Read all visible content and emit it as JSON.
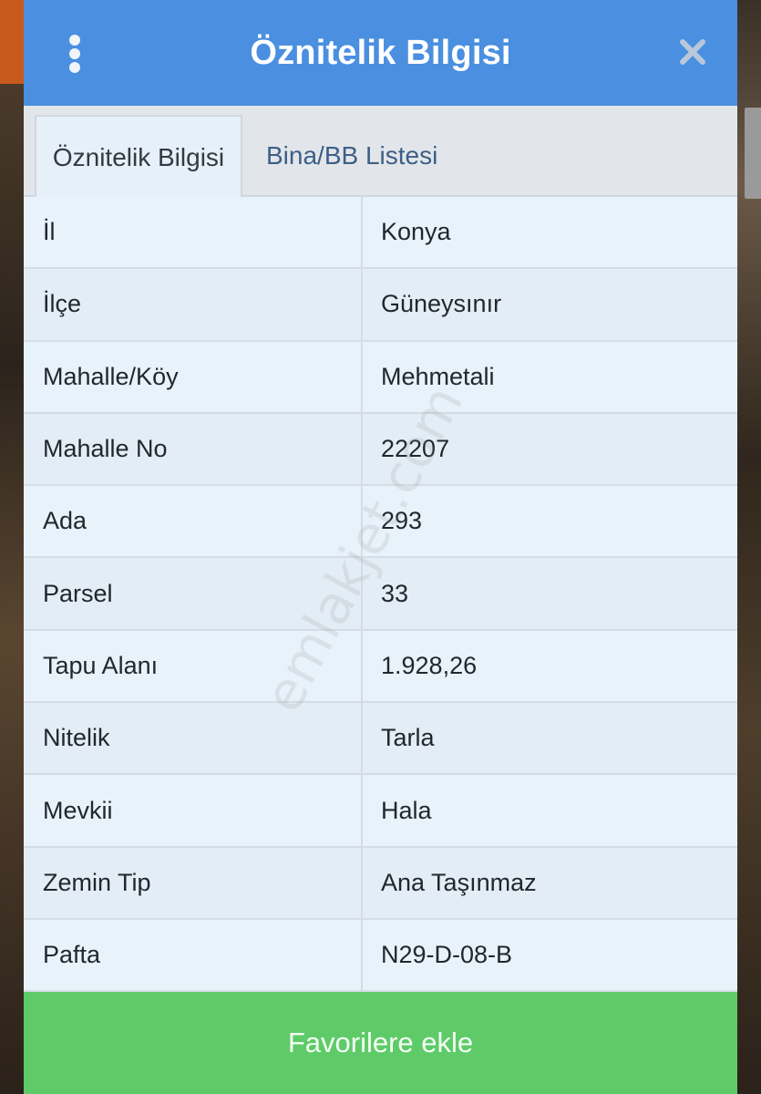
{
  "header": {
    "title": "Öznitelik Bilgisi"
  },
  "tabs": [
    {
      "label": "Öznitelik Bilgisi",
      "active": true
    },
    {
      "label": "Bina/BB Listesi",
      "active": false
    }
  ],
  "attributes": [
    {
      "key": "İl",
      "value": "Konya"
    },
    {
      "key": "İlçe",
      "value": "Güneysınır"
    },
    {
      "key": "Mahalle/Köy",
      "value": "Mehmetali"
    },
    {
      "key": "Mahalle No",
      "value": "22207"
    },
    {
      "key": "Ada",
      "value": "293"
    },
    {
      "key": "Parsel",
      "value": "33"
    },
    {
      "key": "Tapu Alanı",
      "value": "1.928,26"
    },
    {
      "key": "Nitelik",
      "value": "Tarla"
    },
    {
      "key": "Mevkii",
      "value": "Hala"
    },
    {
      "key": "Zemin Tip",
      "value": "Ana Taşınmaz"
    },
    {
      "key": "Pafta",
      "value": "N29-D-08-B"
    }
  ],
  "watermark": "emlakjet.com",
  "footer": {
    "favorite_label": "Favorilere ekle"
  },
  "colors": {
    "header": "#4a8fe0",
    "favorite_button": "#5ecb68"
  },
  "icons": {
    "menu": "more-vertical-icon",
    "close": "close-icon"
  }
}
